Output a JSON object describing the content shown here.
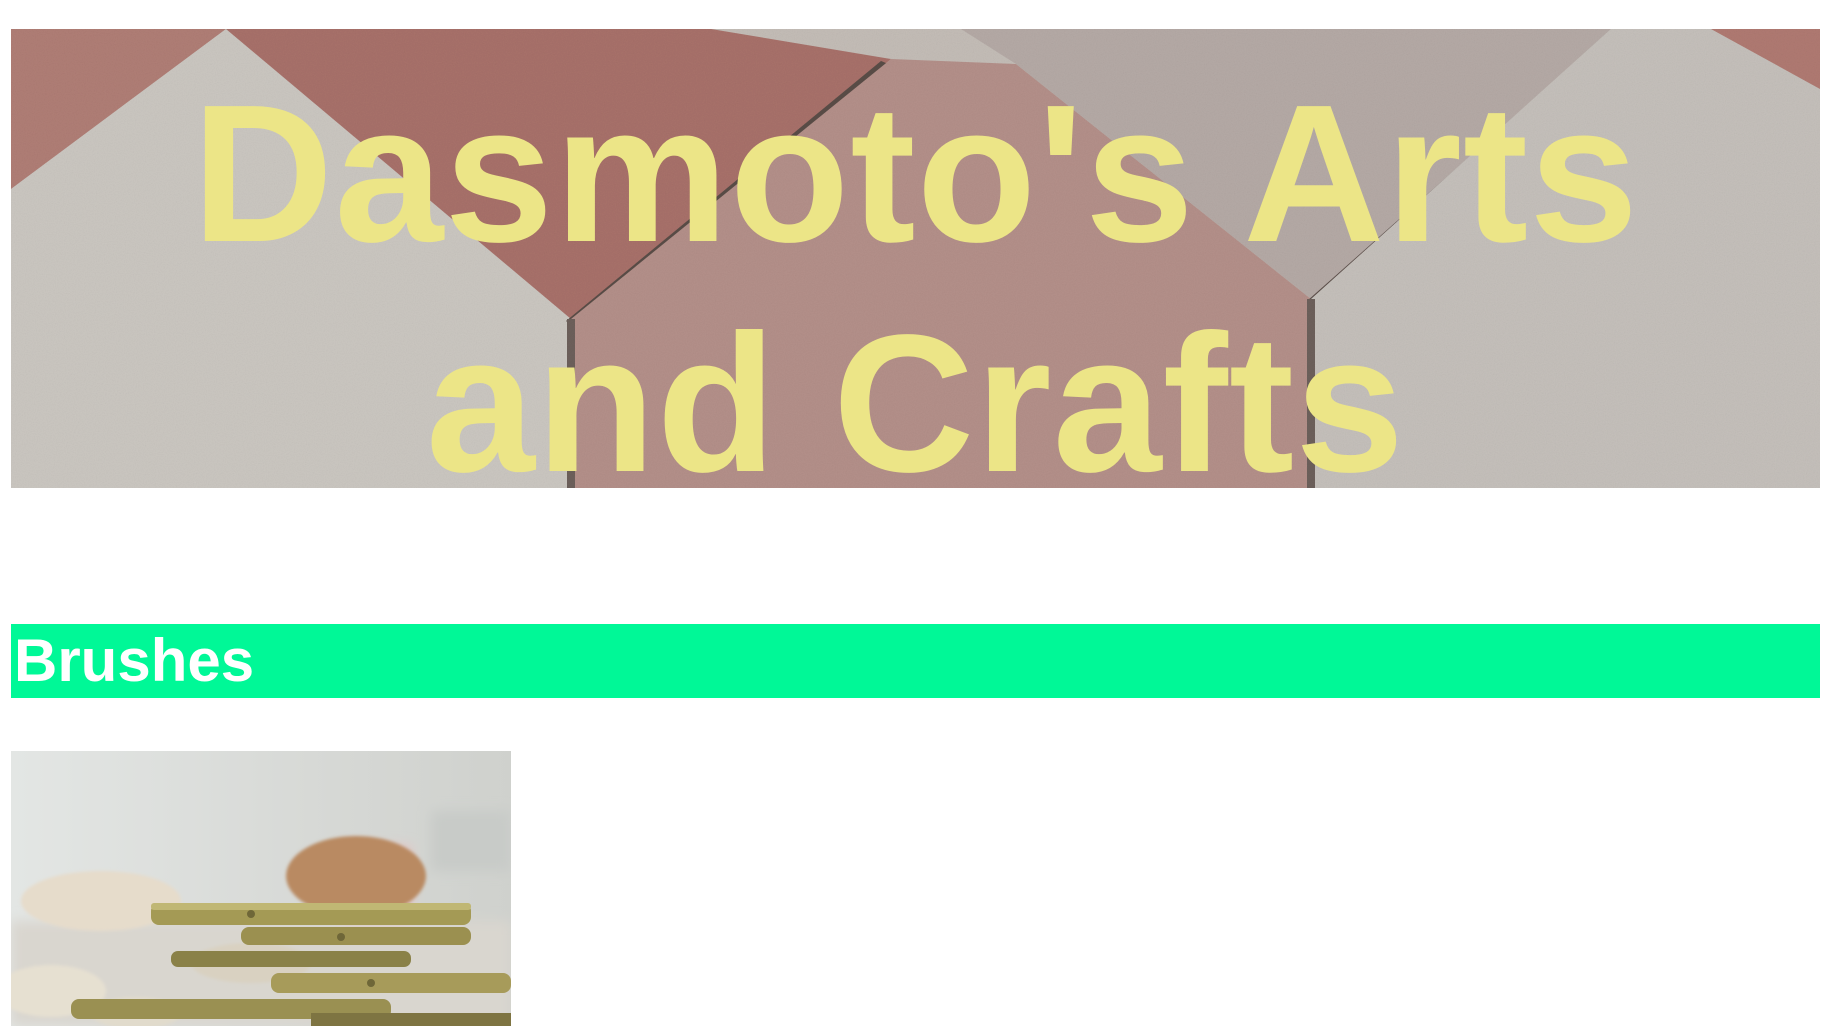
{
  "banner": {
    "title": "Dasmoto's Arts and Crafts",
    "title_color": "#ece587"
  },
  "sections": [
    {
      "heading": "Brushes",
      "heading_color": "#ffffff",
      "background": "#00f897",
      "image_icon": "brushes-photo"
    }
  ]
}
